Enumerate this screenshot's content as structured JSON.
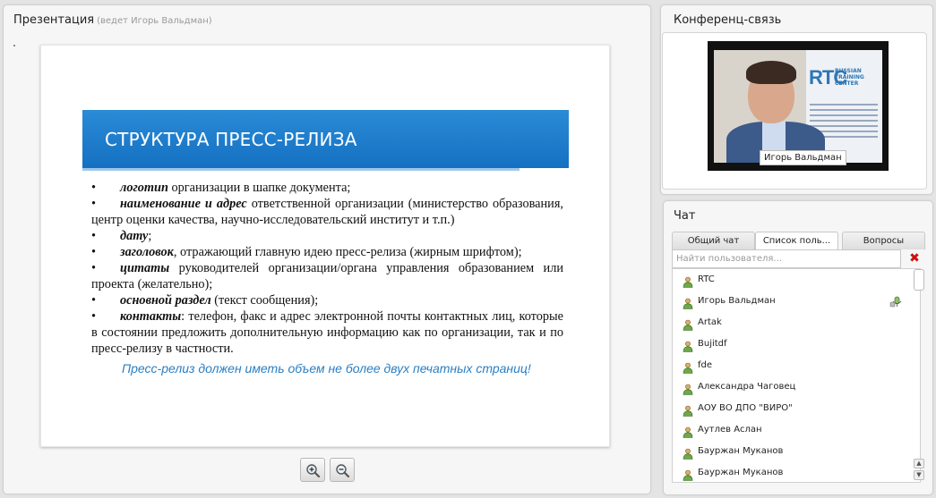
{
  "presentation": {
    "title": "Презентация",
    "presenter": "(ведет Игорь Вальдман)",
    "slide": {
      "header": "СТРУКТУРА ПРЕСС-РЕЛИЗА",
      "bullet": "•",
      "items": [
        {
          "term": "логотип",
          "text": " организации в шапке документа;"
        },
        {
          "term": "наименование и адрес",
          "text": " ответственной организации (министерство образования, центр оценки качества, научно-исследовательский институт и т.п.)"
        },
        {
          "term": "дату",
          "text": ";"
        },
        {
          "term": "заголовок",
          "text": ", отражающий главную идею пресс-релиза (жирным шрифтом);"
        },
        {
          "term": "цитаты",
          "text": " руководителей организации/органа управления образованием или проекта (желательно);"
        },
        {
          "term": "основной раздел",
          "text": " (текст сообщения);"
        },
        {
          "term": "контакты",
          "text": ": телефон, факс и адрес электронной почты контактных лиц, которые в состоянии предложить дополнительную информацию как по организации, так и по пресс-релизу в частности."
        }
      ],
      "note": "Пресс-релиз должен иметь объем не более двух печатных страниц!"
    },
    "zoom": {
      "in_icon": "zoom-in-icon",
      "out_icon": "zoom-out-icon"
    }
  },
  "conference": {
    "title": "Конференц-связь",
    "camera_label": "Игорь Вальдман",
    "poster": {
      "logo": "RTC",
      "lines": [
        "RUSSIAN",
        "TRAINING",
        "CENTER"
      ]
    }
  },
  "chat": {
    "title": "Чат",
    "tabs": [
      {
        "label": "Общий чат",
        "active": false
      },
      {
        "label": "Список поль...",
        "active": true
      },
      {
        "label": "Вопросы",
        "active": false
      }
    ],
    "search_placeholder": "Найти пользователя...",
    "clear_icon": "close-icon",
    "users": [
      {
        "name": "RTC",
        "mic": false
      },
      {
        "name": "Игорь Вальдман",
        "mic": true
      },
      {
        "name": "Artak",
        "mic": false
      },
      {
        "name": "Bujitdf",
        "mic": false
      },
      {
        "name": "fde",
        "mic": false
      },
      {
        "name": "Александра Чаговец",
        "mic": false
      },
      {
        "name": "АОУ ВО ДПО \"ВИРО\"",
        "mic": false
      },
      {
        "name": "Аутлев Аслан",
        "mic": false
      },
      {
        "name": "Бауржан Муканов",
        "mic": false
      },
      {
        "name": "Бауржан Муканов",
        "mic": false
      }
    ]
  },
  "colors": {
    "slide_header": "#1c7cca",
    "note": "#2a7fc4",
    "clear": "#cc1111"
  }
}
